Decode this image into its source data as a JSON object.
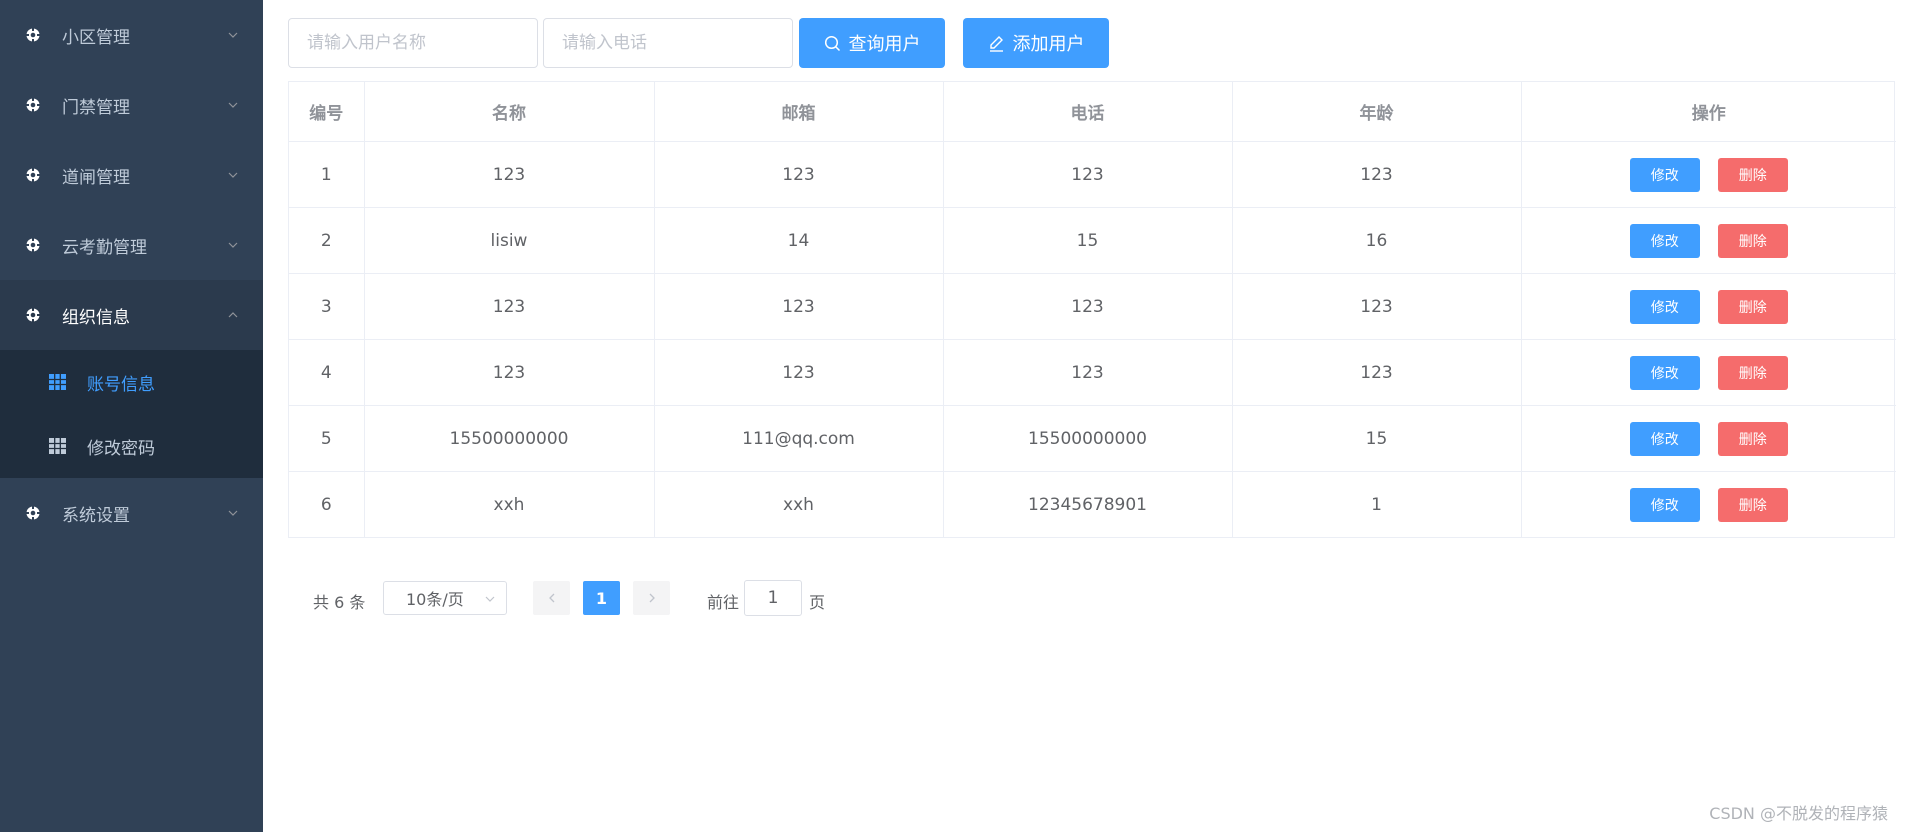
{
  "sidebar": {
    "menus": [
      {
        "label": "小区管理",
        "icon": "gear-icon",
        "expanded": false
      },
      {
        "label": "门禁管理",
        "icon": "gear-icon",
        "expanded": false
      },
      {
        "label": "道闸管理",
        "icon": "gear-icon",
        "expanded": false
      },
      {
        "label": "云考勤管理",
        "icon": "gear-icon",
        "expanded": false
      },
      {
        "label": "组织信息",
        "icon": "gear-icon",
        "expanded": true,
        "children": [
          {
            "label": "账号信息",
            "icon": "grid-icon",
            "active": true
          },
          {
            "label": "修改密码",
            "icon": "grid-icon",
            "active": false
          }
        ]
      },
      {
        "label": "系统设置",
        "icon": "gear-icon",
        "expanded": false
      }
    ]
  },
  "toolbar": {
    "username_placeholder": "请输入用户名称",
    "username_value": "",
    "phone_placeholder": "请输入电话",
    "phone_value": "",
    "search_label": "查询用户",
    "add_label": "添加用户"
  },
  "table": {
    "headers": [
      "编号",
      "名称",
      "邮箱",
      "电话",
      "年龄",
      "操作"
    ],
    "rows": [
      {
        "id": "1",
        "name": "123",
        "email": "123",
        "phone": "123",
        "age": "123"
      },
      {
        "id": "2",
        "name": "lisiw",
        "email": "14",
        "phone": "15",
        "age": "16"
      },
      {
        "id": "3",
        "name": "123",
        "email": "123",
        "phone": "123",
        "age": "123"
      },
      {
        "id": "4",
        "name": "123",
        "email": "123",
        "phone": "123",
        "age": "123"
      },
      {
        "id": "5",
        "name": "15500000000",
        "email": "111@qq.com",
        "phone": "15500000000",
        "age": "15"
      },
      {
        "id": "6",
        "name": "xxh",
        "email": "xxh",
        "phone": "12345678901",
        "age": "1"
      }
    ],
    "edit_label": "修改",
    "delete_label": "删除"
  },
  "pagination": {
    "total_text": "共 6 条",
    "page_size": "10条/页",
    "current_page": "1",
    "goto_label": "前往",
    "goto_value": "1",
    "page_suffix": "页"
  },
  "watermark": "CSDN @不脱发的程序猿",
  "colors": {
    "sidebar_bg": "#304156",
    "submenu_bg": "#1f2d3d",
    "primary": "#409eff",
    "danger": "#f56c6c"
  }
}
